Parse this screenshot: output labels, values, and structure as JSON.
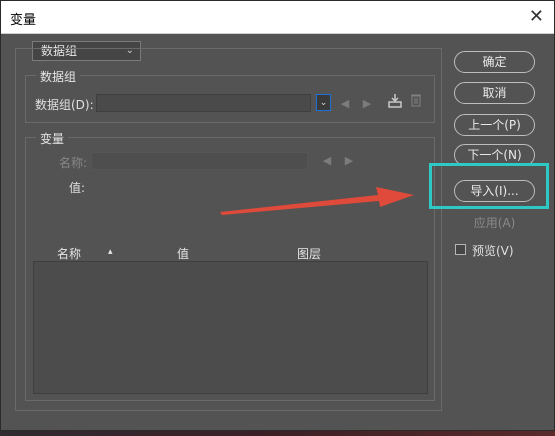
{
  "window": {
    "title": "变量"
  },
  "top_select": {
    "value": "数据组"
  },
  "dataset_group": {
    "title": "数据组",
    "label": "数据组(D):",
    "value": ""
  },
  "variable_group": {
    "title": "变量",
    "name_label": "名称:",
    "name_value": "",
    "value_label": "值:"
  },
  "table": {
    "columns": [
      "名称",
      "值",
      "图层"
    ],
    "sort_indicator": "▴"
  },
  "buttons": {
    "ok": "确定",
    "cancel": "取消",
    "prev": "上一个(P)",
    "next": "下一个(N)",
    "import": "导入(I)...",
    "apply": "应用(A)"
  },
  "preview": {
    "label": "预览(V)",
    "checked": false
  },
  "icons": {
    "dropdown": "chevron-down-icon",
    "prev_nav": "triangle-left-icon",
    "next_nav": "triangle-right-icon",
    "save": "save-dataset-icon",
    "delete": "trash-icon",
    "close": "close-icon"
  },
  "colors": {
    "dialog_bg": "#535353",
    "highlight": "#2ec9c4",
    "annotation_arrow": "#e04a3a",
    "focus_blue": "#1e6fd6"
  }
}
